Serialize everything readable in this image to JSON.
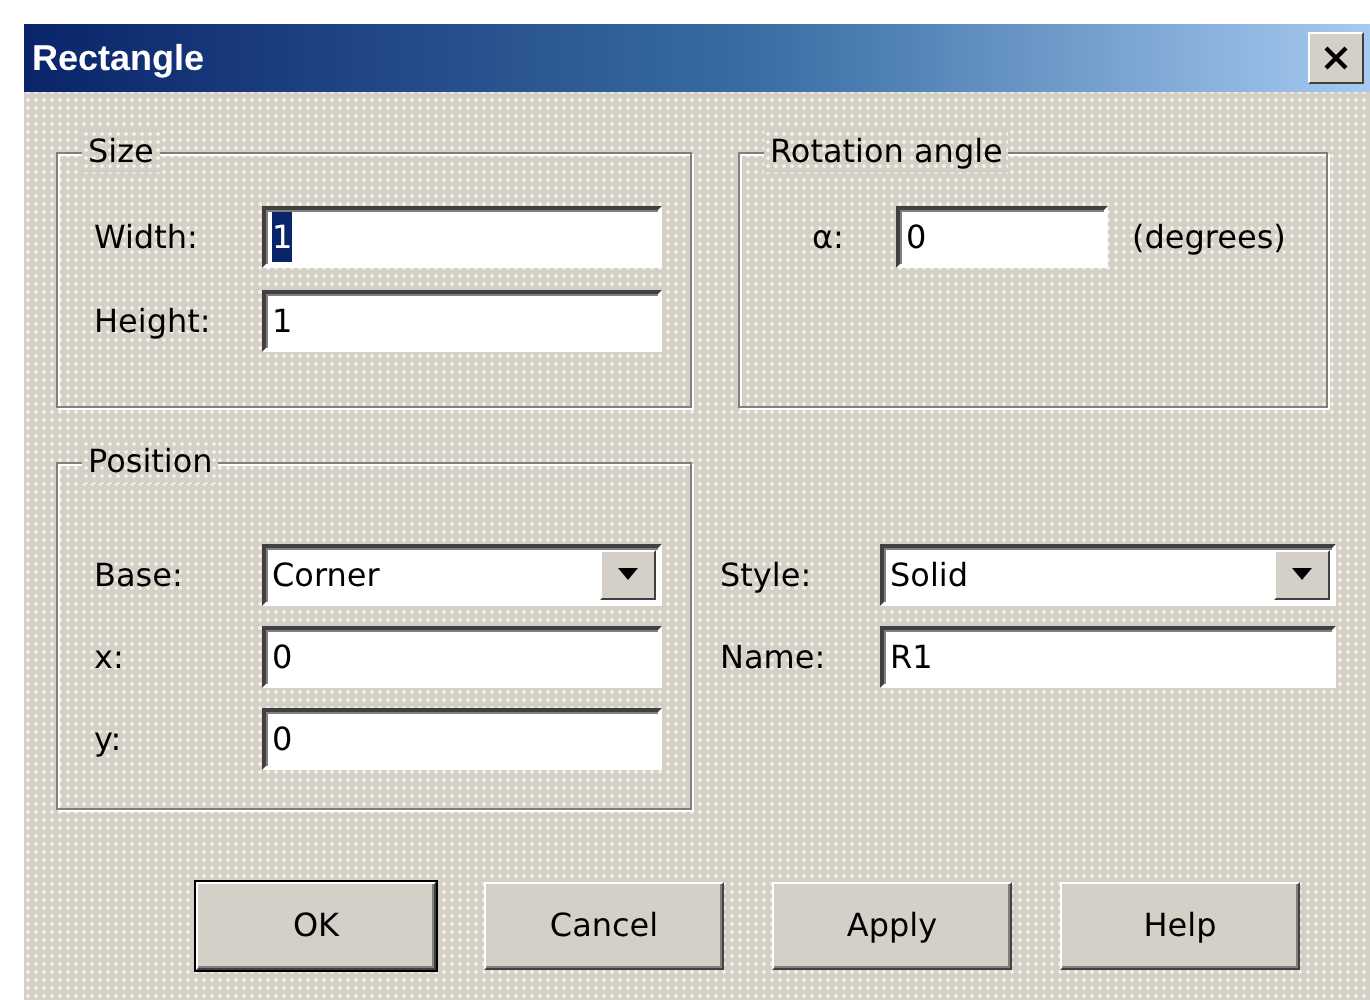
{
  "window": {
    "title": "Rectangle"
  },
  "size_group": {
    "title": "Size",
    "fields": [
      {
        "label": "Width:",
        "value": "1",
        "selected": true
      },
      {
        "label": "Height:",
        "value": "1",
        "selected": false
      }
    ]
  },
  "rotation_group": {
    "title": "Rotation angle",
    "label": "α:",
    "value": "0",
    "unit": "(degrees)"
  },
  "position_group": {
    "title": "Position",
    "fields": [
      {
        "kind": "dropdown",
        "label": "Base:",
        "value": "Corner"
      },
      {
        "kind": "text",
        "label": "x:",
        "value": "0"
      },
      {
        "kind": "text",
        "label": "y:",
        "value": "0"
      }
    ]
  },
  "line_fields": [
    {
      "kind": "dropdown",
      "label": "Style:",
      "value": "Solid"
    },
    {
      "kind": "text",
      "label": "Name:",
      "value": "R1"
    }
  ],
  "buttons": [
    {
      "label": "OK",
      "default": true
    },
    {
      "label": "Cancel",
      "default": false
    },
    {
      "label": "Apply",
      "default": false
    },
    {
      "label": "Help",
      "default": false
    }
  ]
}
